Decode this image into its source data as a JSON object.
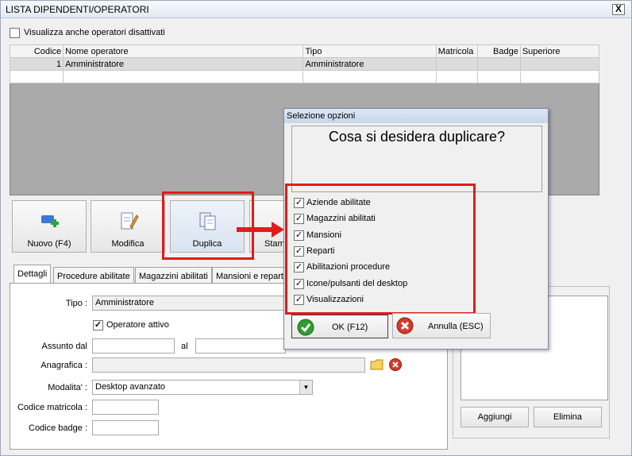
{
  "window": {
    "title": "LISTA DIPENDENTI/OPERATORI",
    "close": "X"
  },
  "show_disabled": {
    "label": "Visualizza anche operatori disattivati",
    "checked": false
  },
  "grid": {
    "columns": [
      "Codice",
      "Nome operatore",
      "Tipo",
      "Matricola",
      "Badge",
      "Superiore"
    ],
    "rows": [
      {
        "codice": "1",
        "nome": "Amministratore",
        "tipo": "Amministratore",
        "matricola": "",
        "badge": "",
        "superiore": ""
      }
    ]
  },
  "toolbar": {
    "new_label": "Nuovo (F4)",
    "edit_label": "Modifica",
    "duplicate_label": "Duplica",
    "print_label": "Stam"
  },
  "tabs": [
    "Dettagli",
    "Procedure abilitate",
    "Magazzini abilitati",
    "Mansioni e repart"
  ],
  "details": {
    "tipo_label": "Tipo :",
    "tipo_value": "Amministratore",
    "attivo_label": "Operatore attivo",
    "attivo_checked": true,
    "assunto_label": "Assunto dal",
    "al_label": "al",
    "anagrafica_label": "Anagrafica :",
    "modalita_label": "Modalita' :",
    "modalita_value": "Desktop avanzato",
    "matricola_label": "Codice matricola :",
    "badge_label": "Codice badge :"
  },
  "right_panel": {
    "add_label": "Aggiungi",
    "delete_label": "Elimina"
  },
  "dialog": {
    "title": "Selezione opzioni",
    "question": "Cosa si desidera duplicare?",
    "options": [
      {
        "label": "Aziende abilitate",
        "checked": true
      },
      {
        "label": "Magazzini abilitati",
        "checked": true
      },
      {
        "label": "Mansioni",
        "checked": true
      },
      {
        "label": "Reparti",
        "checked": true
      },
      {
        "label": "Abilitazioni procedure",
        "checked": true
      },
      {
        "label": "Icone/pulsanti del desktop",
        "checked": true
      },
      {
        "label": "Visualizzazioni",
        "checked": true
      }
    ],
    "ok_label": "OK (F12)",
    "cancel_label": "Annulla (ESC)"
  },
  "colors": {
    "highlight": "#e21b1b",
    "ok": "#2e9e2e",
    "cancel": "#d63a2a"
  }
}
